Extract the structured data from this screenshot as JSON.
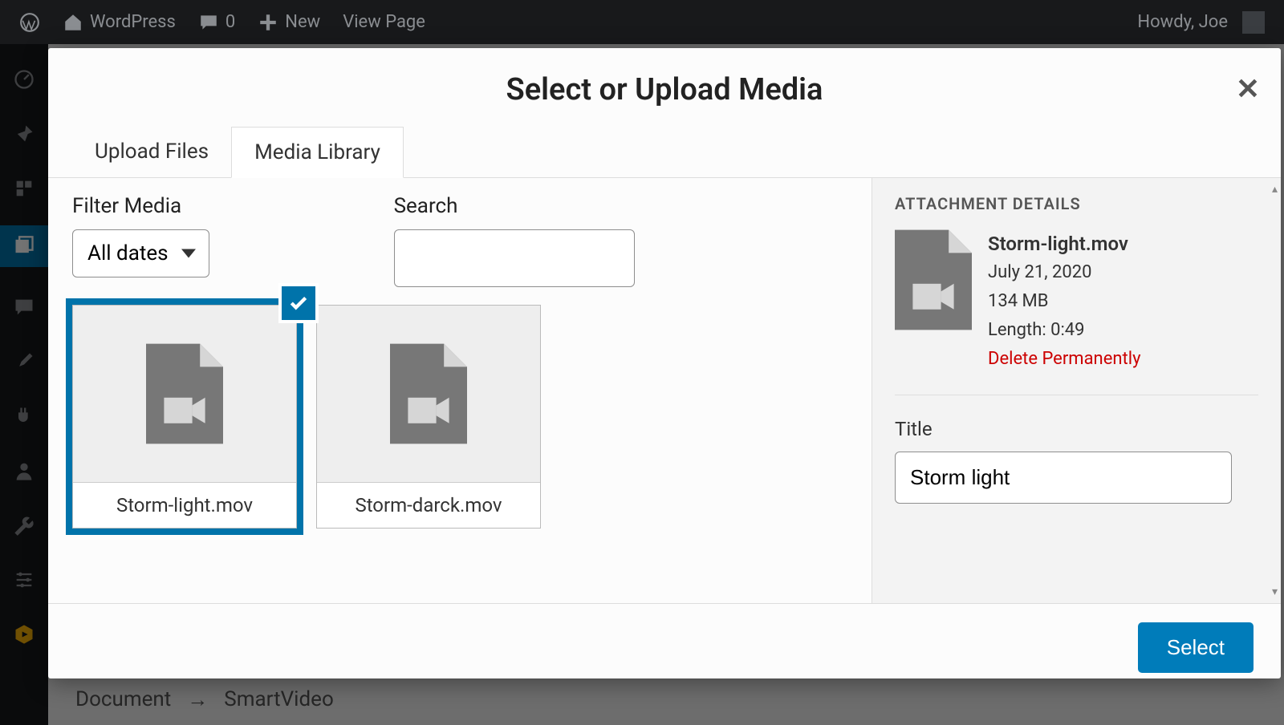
{
  "adminbar": {
    "site_title": "WordPress",
    "comments_count": "0",
    "new_label": "New",
    "view_page_label": "View Page",
    "howdy": "Howdy, Joe"
  },
  "breadcrumb": {
    "a": "Document",
    "arrow": "→",
    "b": "SmartVideo"
  },
  "modal": {
    "title": "Select or Upload Media",
    "tab_upload": "Upload Files",
    "tab_library": "Media Library",
    "filter_label": "Filter Media",
    "filter_value": "All dates",
    "search_label": "Search",
    "details_header": "ATTACHMENT DETAILS",
    "title_label": "Title",
    "title_value": "Storm light",
    "delete_label": "Delete Permanently",
    "select_btn": "Select"
  },
  "attachment": {
    "filename": "Storm-light.mov",
    "date": "July 21, 2020",
    "size": "134 MB",
    "length": "Length: 0:49"
  },
  "media": [
    {
      "filename": "Storm-light.mov",
      "selected": true
    },
    {
      "filename": "Storm-darck.mov",
      "selected": false
    }
  ]
}
